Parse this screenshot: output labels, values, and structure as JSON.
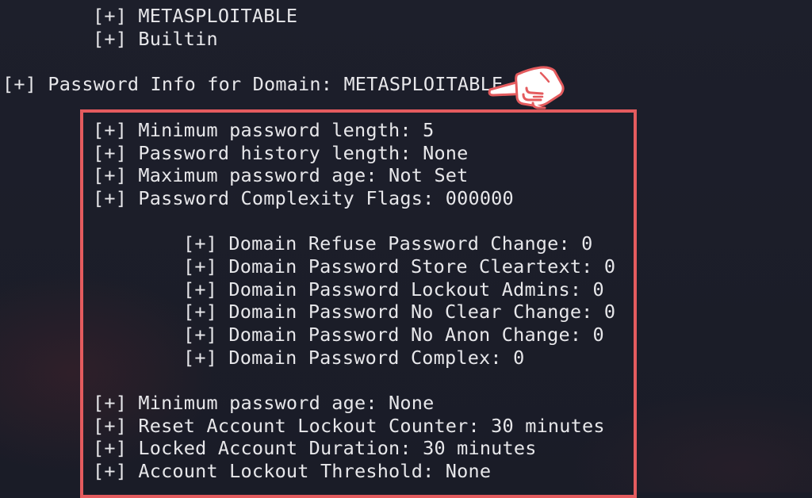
{
  "terminal": {
    "header_lines": [
      "[+] METASPLOITABLE",
      "[+] Builtin"
    ],
    "password_info_title": "[+] Password Info for Domain: METASPLOITABLE",
    "policy": {
      "min_length": "[+] Minimum password length: 5",
      "history_length": "[+] Password history length: None",
      "max_age": "[+] Maximum password age: Not Set",
      "complexity_flags": "[+] Password Complexity Flags: 000000"
    },
    "flags": [
      "[+] Domain Refuse Password Change: 0",
      "[+] Domain Password Store Cleartext: 0",
      "[+] Domain Password Lockout Admins: 0",
      "[+] Domain Password No Clear Change: 0",
      "[+] Domain Password No Anon Change: 0",
      "[+] Domain Password Complex: 0"
    ],
    "lockout": {
      "min_age": "[+] Minimum password age: None",
      "reset_counter": "[+] Reset Account Lockout Counter: 30 minutes",
      "locked_duration": "[+] Locked Account Duration: 30 minutes",
      "threshold": "[+] Account Lockout Threshold: None"
    }
  },
  "colors": {
    "background": "#1a1c28",
    "text": "#e7e7ea",
    "highlight": "#e45b5e"
  },
  "icons": {
    "pointer": "pointing-hand-icon"
  }
}
